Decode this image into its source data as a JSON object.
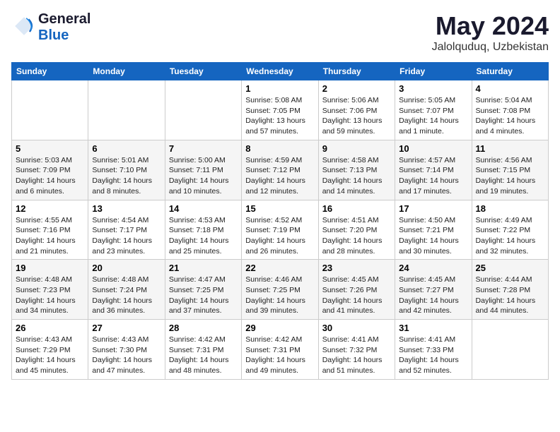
{
  "header": {
    "logo": {
      "line1": "General",
      "line2": "Blue"
    },
    "title": "May 2024",
    "location": "Jalolquduq, Uzbekistan"
  },
  "weekdays": [
    "Sunday",
    "Monday",
    "Tuesday",
    "Wednesday",
    "Thursday",
    "Friday",
    "Saturday"
  ],
  "weeks": [
    [
      {
        "day": "",
        "info": ""
      },
      {
        "day": "",
        "info": ""
      },
      {
        "day": "",
        "info": ""
      },
      {
        "day": "1",
        "info": "Sunrise: 5:08 AM\nSunset: 7:05 PM\nDaylight: 13 hours\nand 57 minutes."
      },
      {
        "day": "2",
        "info": "Sunrise: 5:06 AM\nSunset: 7:06 PM\nDaylight: 13 hours\nand 59 minutes."
      },
      {
        "day": "3",
        "info": "Sunrise: 5:05 AM\nSunset: 7:07 PM\nDaylight: 14 hours\nand 1 minute."
      },
      {
        "day": "4",
        "info": "Sunrise: 5:04 AM\nSunset: 7:08 PM\nDaylight: 14 hours\nand 4 minutes."
      }
    ],
    [
      {
        "day": "5",
        "info": "Sunrise: 5:03 AM\nSunset: 7:09 PM\nDaylight: 14 hours\nand 6 minutes."
      },
      {
        "day": "6",
        "info": "Sunrise: 5:01 AM\nSunset: 7:10 PM\nDaylight: 14 hours\nand 8 minutes."
      },
      {
        "day": "7",
        "info": "Sunrise: 5:00 AM\nSunset: 7:11 PM\nDaylight: 14 hours\nand 10 minutes."
      },
      {
        "day": "8",
        "info": "Sunrise: 4:59 AM\nSunset: 7:12 PM\nDaylight: 14 hours\nand 12 minutes."
      },
      {
        "day": "9",
        "info": "Sunrise: 4:58 AM\nSunset: 7:13 PM\nDaylight: 14 hours\nand 14 minutes."
      },
      {
        "day": "10",
        "info": "Sunrise: 4:57 AM\nSunset: 7:14 PM\nDaylight: 14 hours\nand 17 minutes."
      },
      {
        "day": "11",
        "info": "Sunrise: 4:56 AM\nSunset: 7:15 PM\nDaylight: 14 hours\nand 19 minutes."
      }
    ],
    [
      {
        "day": "12",
        "info": "Sunrise: 4:55 AM\nSunset: 7:16 PM\nDaylight: 14 hours\nand 21 minutes."
      },
      {
        "day": "13",
        "info": "Sunrise: 4:54 AM\nSunset: 7:17 PM\nDaylight: 14 hours\nand 23 minutes."
      },
      {
        "day": "14",
        "info": "Sunrise: 4:53 AM\nSunset: 7:18 PM\nDaylight: 14 hours\nand 25 minutes."
      },
      {
        "day": "15",
        "info": "Sunrise: 4:52 AM\nSunset: 7:19 PM\nDaylight: 14 hours\nand 26 minutes."
      },
      {
        "day": "16",
        "info": "Sunrise: 4:51 AM\nSunset: 7:20 PM\nDaylight: 14 hours\nand 28 minutes."
      },
      {
        "day": "17",
        "info": "Sunrise: 4:50 AM\nSunset: 7:21 PM\nDaylight: 14 hours\nand 30 minutes."
      },
      {
        "day": "18",
        "info": "Sunrise: 4:49 AM\nSunset: 7:22 PM\nDaylight: 14 hours\nand 32 minutes."
      }
    ],
    [
      {
        "day": "19",
        "info": "Sunrise: 4:48 AM\nSunset: 7:23 PM\nDaylight: 14 hours\nand 34 minutes."
      },
      {
        "day": "20",
        "info": "Sunrise: 4:48 AM\nSunset: 7:24 PM\nDaylight: 14 hours\nand 36 minutes."
      },
      {
        "day": "21",
        "info": "Sunrise: 4:47 AM\nSunset: 7:25 PM\nDaylight: 14 hours\nand 37 minutes."
      },
      {
        "day": "22",
        "info": "Sunrise: 4:46 AM\nSunset: 7:25 PM\nDaylight: 14 hours\nand 39 minutes."
      },
      {
        "day": "23",
        "info": "Sunrise: 4:45 AM\nSunset: 7:26 PM\nDaylight: 14 hours\nand 41 minutes."
      },
      {
        "day": "24",
        "info": "Sunrise: 4:45 AM\nSunset: 7:27 PM\nDaylight: 14 hours\nand 42 minutes."
      },
      {
        "day": "25",
        "info": "Sunrise: 4:44 AM\nSunset: 7:28 PM\nDaylight: 14 hours\nand 44 minutes."
      }
    ],
    [
      {
        "day": "26",
        "info": "Sunrise: 4:43 AM\nSunset: 7:29 PM\nDaylight: 14 hours\nand 45 minutes."
      },
      {
        "day": "27",
        "info": "Sunrise: 4:43 AM\nSunset: 7:30 PM\nDaylight: 14 hours\nand 47 minutes."
      },
      {
        "day": "28",
        "info": "Sunrise: 4:42 AM\nSunset: 7:31 PM\nDaylight: 14 hours\nand 48 minutes."
      },
      {
        "day": "29",
        "info": "Sunrise: 4:42 AM\nSunset: 7:31 PM\nDaylight: 14 hours\nand 49 minutes."
      },
      {
        "day": "30",
        "info": "Sunrise: 4:41 AM\nSunset: 7:32 PM\nDaylight: 14 hours\nand 51 minutes."
      },
      {
        "day": "31",
        "info": "Sunrise: 4:41 AM\nSunset: 7:33 PM\nDaylight: 14 hours\nand 52 minutes."
      },
      {
        "day": "",
        "info": ""
      }
    ]
  ]
}
